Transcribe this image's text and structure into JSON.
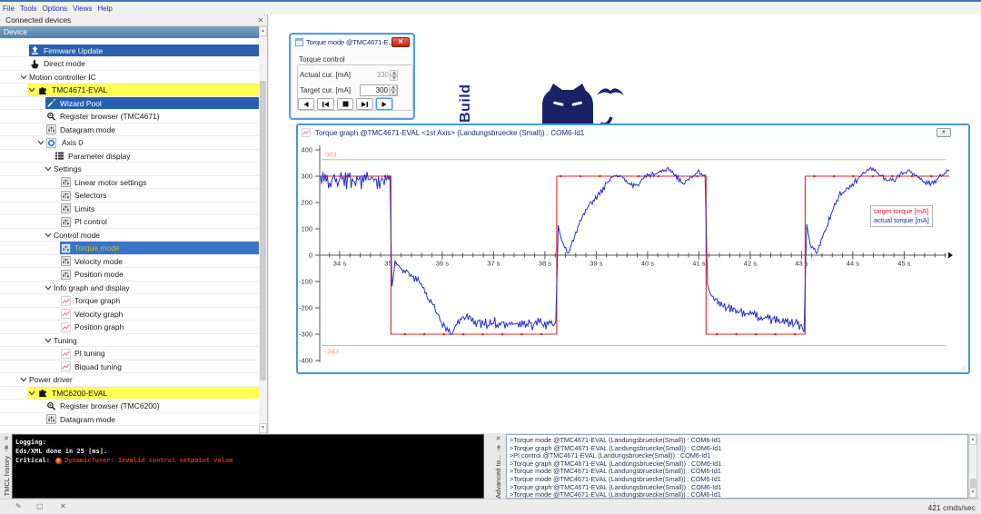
{
  "menu": {
    "items": [
      "File",
      "Tools",
      "Options",
      "Views",
      "Help"
    ]
  },
  "left_panel": {
    "title": "Connected devices",
    "close_label": "x",
    "tree_header": "Device",
    "rows": [
      {
        "label": "Firmware Update",
        "icon": "upload",
        "chev": false,
        "style": "sel",
        "hl": 32,
        "ix": 33,
        "tx": 48
      },
      {
        "label": "Direct mode",
        "icon": "hand",
        "chev": false,
        "style": "",
        "ix": 33,
        "tx": 48
      },
      {
        "label": "Motion controller IC",
        "icon": null,
        "chev": true,
        "style": "",
        "cx": 22,
        "tx": 32
      },
      {
        "label": "TMC4671-EVAL",
        "icon": "puzzle",
        "chev": true,
        "style": "yellow",
        "hl": 30,
        "cx": 31,
        "ix": 42,
        "tx": 57
      },
      {
        "label": "Wizard Pool",
        "icon": "wand",
        "chev": false,
        "style": "sel",
        "hl": 50,
        "ix": 51,
        "tx": 66
      },
      {
        "label": "Register browser (TMC4671)",
        "icon": "magnifier",
        "chev": false,
        "style": "",
        "ix": 51,
        "tx": 66
      },
      {
        "label": "Datagram mode",
        "icon": "sliders",
        "chev": false,
        "style": "",
        "ix": 51,
        "tx": 66
      },
      {
        "label": "Axis 0",
        "icon": "axis",
        "chev": true,
        "style": "",
        "cx": 41,
        "ix": 51,
        "tx": 68
      },
      {
        "label": "Parameter display",
        "icon": "list",
        "chev": false,
        "style": "",
        "ix": 60,
        "tx": 75
      },
      {
        "label": "Settings",
        "icon": null,
        "chev": true,
        "style": "",
        "cx": 49,
        "tx": 59
      },
      {
        "label": "Linear motor settings",
        "icon": "sliders",
        "chev": false,
        "style": "",
        "ix": 67,
        "tx": 82
      },
      {
        "label": "Selectors",
        "icon": "sliders",
        "chev": false,
        "style": "",
        "ix": 67,
        "tx": 82
      },
      {
        "label": "Limits",
        "icon": "sliders",
        "chev": false,
        "style": "",
        "ix": 67,
        "tx": 82
      },
      {
        "label": "PI control",
        "icon": "sliders",
        "chev": false,
        "style": "",
        "ix": 67,
        "tx": 82
      },
      {
        "label": "Control mode",
        "icon": null,
        "chev": true,
        "style": "",
        "cx": 49,
        "tx": 59
      },
      {
        "label": "Torque mode",
        "icon": "sliders-active",
        "chev": false,
        "style": "active",
        "hl": 66,
        "ix": 67,
        "tx": 82
      },
      {
        "label": "Velocity mode",
        "icon": "sliders",
        "chev": false,
        "style": "",
        "ix": 67,
        "tx": 82
      },
      {
        "label": "Position mode",
        "icon": "sliders",
        "chev": false,
        "style": "",
        "ix": 67,
        "tx": 82
      },
      {
        "label": "Info graph and display",
        "icon": null,
        "chev": true,
        "style": "",
        "cx": 49,
        "tx": 59
      },
      {
        "label": "Torque graph",
        "icon": "chart",
        "chev": false,
        "style": "",
        "ix": 67,
        "tx": 82
      },
      {
        "label": "Velocity graph",
        "icon": "chart",
        "chev": false,
        "style": "",
        "ix": 67,
        "tx": 82
      },
      {
        "label": "Position graph",
        "icon": "chart",
        "chev": false,
        "style": "",
        "ix": 67,
        "tx": 82
      },
      {
        "label": "Tuning",
        "icon": null,
        "chev": true,
        "style": "",
        "cx": 49,
        "tx": 59
      },
      {
        "label": "PI tuning",
        "icon": "chart",
        "chev": false,
        "style": "",
        "ix": 67,
        "tx": 82
      },
      {
        "label": "Biquad tuning",
        "icon": "chart",
        "chev": false,
        "style": "",
        "ix": 67,
        "tx": 82
      },
      {
        "label": "Power driver",
        "icon": null,
        "chev": true,
        "style": "",
        "cx": 22,
        "tx": 32
      },
      {
        "label": "TMC6200-EVAL",
        "icon": "puzzle",
        "chev": true,
        "style": "yellow",
        "hl": 30,
        "cx": 31,
        "ix": 42,
        "tx": 57
      },
      {
        "label": "Register browser (TMC6200)",
        "icon": "magnifier",
        "chev": false,
        "style": "",
        "ix": 51,
        "tx": 66
      },
      {
        "label": "Datagram mode",
        "icon": "sliders",
        "chev": false,
        "style": "",
        "ix": 51,
        "tx": 66
      }
    ]
  },
  "watermark": {
    "text": "Build"
  },
  "torque_dialog": {
    "title": "Torque mode @TMC4671-E...",
    "close_label": "x",
    "group": "Torque control",
    "fields": [
      {
        "label": "Actual cur. [mA]",
        "value": "330",
        "disabled": true
      },
      {
        "label": "Target cur. [mA]",
        "value": "300",
        "disabled": false
      }
    ],
    "media_buttons": [
      "step-back",
      "skip-start",
      "stop",
      "skip-end",
      "play"
    ]
  },
  "graph_window": {
    "title": "Torque graph @TMC4671-EVAL <1st Axis> (Landungsbruecke (Small)) : COM6-Id1",
    "window_button": "x"
  },
  "chart_data": {
    "type": "line",
    "title": "Torque graph",
    "x_unit": "s",
    "x_range": [
      33.63,
      45.88
    ],
    "x_ticks": [
      34,
      35,
      36,
      37,
      38,
      39,
      40,
      41,
      42,
      43,
      44,
      45
    ],
    "y_range": [
      -400,
      400
    ],
    "y_ticks": [
      -400,
      -300,
      -200,
      -100,
      0,
      100,
      200,
      300,
      400
    ],
    "limit_lines": [
      {
        "value": 363,
        "label": "363"
      },
      {
        "value": -343,
        "label": "-343"
      }
    ],
    "legend_entries": [
      {
        "name": "target torque [mA]",
        "color": "#e02828"
      },
      {
        "name": "actual torque [mA]",
        "color": "#2830c8"
      }
    ],
    "series": [
      {
        "name": "target torque [mA]",
        "color": "#e02828",
        "marker_interval": 0.38,
        "points": [
          [
            33.63,
            300
          ],
          [
            35.0,
            300
          ],
          [
            35.0,
            -300
          ],
          [
            38.23,
            -300
          ],
          [
            38.23,
            300
          ],
          [
            41.14,
            300
          ],
          [
            41.14,
            -300
          ],
          [
            43.07,
            -300
          ],
          [
            43.07,
            300
          ],
          [
            45.88,
            300
          ]
        ]
      },
      {
        "name": "actual torque [mA]",
        "color": "#2830c8",
        "anchors": [
          [
            33.63,
            283,
            24
          ],
          [
            34.4,
            287,
            24
          ],
          [
            34.98,
            286,
            22
          ],
          [
            35.02,
            -118,
            0
          ],
          [
            35.08,
            -30,
            6
          ],
          [
            35.3,
            -62,
            10
          ],
          [
            35.55,
            -100,
            10
          ],
          [
            35.8,
            -185,
            12
          ],
          [
            36.05,
            -278,
            10
          ],
          [
            36.18,
            -298,
            8
          ],
          [
            36.35,
            -238,
            12
          ],
          [
            36.55,
            -242,
            14
          ],
          [
            36.8,
            -264,
            16
          ],
          [
            37.2,
            -254,
            16
          ],
          [
            37.6,
            -264,
            16
          ],
          [
            38.0,
            -258,
            16
          ],
          [
            38.21,
            -264,
            12
          ],
          [
            38.26,
            114,
            0
          ],
          [
            38.32,
            60,
            5
          ],
          [
            38.45,
            8,
            5
          ],
          [
            38.6,
            80,
            8
          ],
          [
            38.75,
            160,
            8
          ],
          [
            38.9,
            200,
            8
          ],
          [
            39.05,
            228,
            8
          ],
          [
            39.2,
            270,
            8
          ],
          [
            39.35,
            304,
            6
          ],
          [
            39.5,
            300,
            6
          ],
          [
            39.65,
            268,
            6
          ],
          [
            39.8,
            262,
            6
          ],
          [
            39.95,
            298,
            6
          ],
          [
            40.1,
            306,
            6
          ],
          [
            40.25,
            316,
            6
          ],
          [
            40.4,
            328,
            6
          ],
          [
            40.55,
            298,
            6
          ],
          [
            40.7,
            272,
            6
          ],
          [
            40.85,
            298,
            6
          ],
          [
            41.0,
            316,
            6
          ],
          [
            41.12,
            300,
            4
          ],
          [
            41.17,
            -114,
            0
          ],
          [
            41.23,
            -152,
            6
          ],
          [
            41.35,
            -176,
            8
          ],
          [
            41.5,
            -195,
            10
          ],
          [
            41.7,
            -210,
            10
          ],
          [
            42.0,
            -225,
            12
          ],
          [
            42.3,
            -240,
            12
          ],
          [
            42.6,
            -250,
            12
          ],
          [
            42.9,
            -262,
            13
          ],
          [
            43.0,
            -268,
            13
          ],
          [
            43.05,
            -298,
            4
          ],
          [
            43.1,
            118,
            0
          ],
          [
            43.17,
            40,
            5
          ],
          [
            43.3,
            8,
            5
          ],
          [
            43.45,
            88,
            8
          ],
          [
            43.6,
            166,
            8
          ],
          [
            43.75,
            230,
            8
          ],
          [
            43.9,
            256,
            8
          ],
          [
            44.05,
            280,
            8
          ],
          [
            44.2,
            308,
            6
          ],
          [
            44.35,
            328,
            6
          ],
          [
            44.5,
            310,
            6
          ],
          [
            44.65,
            286,
            6
          ],
          [
            44.8,
            284,
            6
          ],
          [
            44.95,
            308,
            6
          ],
          [
            45.1,
            318,
            6
          ],
          [
            45.25,
            296,
            6
          ],
          [
            45.4,
            274,
            6
          ],
          [
            45.55,
            272,
            6
          ],
          [
            45.7,
            298,
            6
          ],
          [
            45.85,
            320,
            6
          ],
          [
            45.88,
            324,
            4
          ]
        ]
      }
    ]
  },
  "consoles": {
    "tmcl": {
      "tab": "TMCL history",
      "lines": [
        {
          "text": "Logging:"
        },
        {
          "text": "Eds/XML done in 25 [ms]."
        },
        {
          "prefix": "Critical:",
          "error": "DynamicTuner: Invalid control setpoint value"
        }
      ]
    },
    "advanced": {
      "tab": "Advanced to...",
      "lines": [
        ">Torque mode @TMC4671-EVAL (Landungsbruecke(Small)) : COM6-Id1",
        ">Torque graph @TMC4671-EVAL (Landungsbruecke(Small)) : COM6-Id1",
        ">PI control @TMC4671-EVAL (Landungsbruecke(Small)) : COM6-Id1",
        ">Torque graph @TMC4671-EVAL (Landungsbruecke(Small)) : COM6-Id1",
        ">Torque mode @TMC4671-EVAL (Landungsbruecke(Small)) : COM6-Id1",
        ">Torque mode @TMC4671-EVAL (Landungsbruecke(Small)) : COM6-Id1",
        ">Torque graph @TMC4671-EVAL (Landungsbruecke(Small)) : COM6-Id1",
        ">Torque mode @TMC4671-EVAL (Landungsbruecke(Small)) : COM6-Id1"
      ]
    }
  },
  "status_bar": {
    "rate": "421 cmds/sec"
  }
}
